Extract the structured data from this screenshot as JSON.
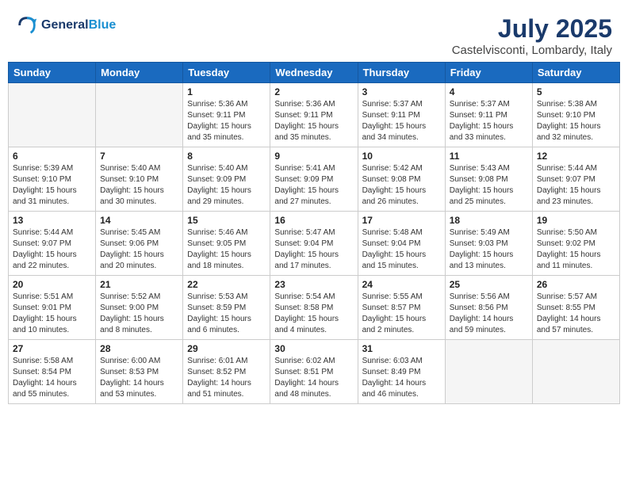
{
  "logo": {
    "line1": "General",
    "line2": "Blue"
  },
  "title": "July 2025",
  "location": "Castelvisconti, Lombardy, Italy",
  "headers": [
    "Sunday",
    "Monday",
    "Tuesday",
    "Wednesday",
    "Thursday",
    "Friday",
    "Saturday"
  ],
  "weeks": [
    [
      {
        "day": "",
        "content": ""
      },
      {
        "day": "",
        "content": ""
      },
      {
        "day": "1",
        "content": "Sunrise: 5:36 AM\nSunset: 9:11 PM\nDaylight: 15 hours\nand 35 minutes."
      },
      {
        "day": "2",
        "content": "Sunrise: 5:36 AM\nSunset: 9:11 PM\nDaylight: 15 hours\nand 35 minutes."
      },
      {
        "day": "3",
        "content": "Sunrise: 5:37 AM\nSunset: 9:11 PM\nDaylight: 15 hours\nand 34 minutes."
      },
      {
        "day": "4",
        "content": "Sunrise: 5:37 AM\nSunset: 9:11 PM\nDaylight: 15 hours\nand 33 minutes."
      },
      {
        "day": "5",
        "content": "Sunrise: 5:38 AM\nSunset: 9:10 PM\nDaylight: 15 hours\nand 32 minutes."
      }
    ],
    [
      {
        "day": "6",
        "content": "Sunrise: 5:39 AM\nSunset: 9:10 PM\nDaylight: 15 hours\nand 31 minutes."
      },
      {
        "day": "7",
        "content": "Sunrise: 5:40 AM\nSunset: 9:10 PM\nDaylight: 15 hours\nand 30 minutes."
      },
      {
        "day": "8",
        "content": "Sunrise: 5:40 AM\nSunset: 9:09 PM\nDaylight: 15 hours\nand 29 minutes."
      },
      {
        "day": "9",
        "content": "Sunrise: 5:41 AM\nSunset: 9:09 PM\nDaylight: 15 hours\nand 27 minutes."
      },
      {
        "day": "10",
        "content": "Sunrise: 5:42 AM\nSunset: 9:08 PM\nDaylight: 15 hours\nand 26 minutes."
      },
      {
        "day": "11",
        "content": "Sunrise: 5:43 AM\nSunset: 9:08 PM\nDaylight: 15 hours\nand 25 minutes."
      },
      {
        "day": "12",
        "content": "Sunrise: 5:44 AM\nSunset: 9:07 PM\nDaylight: 15 hours\nand 23 minutes."
      }
    ],
    [
      {
        "day": "13",
        "content": "Sunrise: 5:44 AM\nSunset: 9:07 PM\nDaylight: 15 hours\nand 22 minutes."
      },
      {
        "day": "14",
        "content": "Sunrise: 5:45 AM\nSunset: 9:06 PM\nDaylight: 15 hours\nand 20 minutes."
      },
      {
        "day": "15",
        "content": "Sunrise: 5:46 AM\nSunset: 9:05 PM\nDaylight: 15 hours\nand 18 minutes."
      },
      {
        "day": "16",
        "content": "Sunrise: 5:47 AM\nSunset: 9:04 PM\nDaylight: 15 hours\nand 17 minutes."
      },
      {
        "day": "17",
        "content": "Sunrise: 5:48 AM\nSunset: 9:04 PM\nDaylight: 15 hours\nand 15 minutes."
      },
      {
        "day": "18",
        "content": "Sunrise: 5:49 AM\nSunset: 9:03 PM\nDaylight: 15 hours\nand 13 minutes."
      },
      {
        "day": "19",
        "content": "Sunrise: 5:50 AM\nSunset: 9:02 PM\nDaylight: 15 hours\nand 11 minutes."
      }
    ],
    [
      {
        "day": "20",
        "content": "Sunrise: 5:51 AM\nSunset: 9:01 PM\nDaylight: 15 hours\nand 10 minutes."
      },
      {
        "day": "21",
        "content": "Sunrise: 5:52 AM\nSunset: 9:00 PM\nDaylight: 15 hours\nand 8 minutes."
      },
      {
        "day": "22",
        "content": "Sunrise: 5:53 AM\nSunset: 8:59 PM\nDaylight: 15 hours\nand 6 minutes."
      },
      {
        "day": "23",
        "content": "Sunrise: 5:54 AM\nSunset: 8:58 PM\nDaylight: 15 hours\nand 4 minutes."
      },
      {
        "day": "24",
        "content": "Sunrise: 5:55 AM\nSunset: 8:57 PM\nDaylight: 15 hours\nand 2 minutes."
      },
      {
        "day": "25",
        "content": "Sunrise: 5:56 AM\nSunset: 8:56 PM\nDaylight: 14 hours\nand 59 minutes."
      },
      {
        "day": "26",
        "content": "Sunrise: 5:57 AM\nSunset: 8:55 PM\nDaylight: 14 hours\nand 57 minutes."
      }
    ],
    [
      {
        "day": "27",
        "content": "Sunrise: 5:58 AM\nSunset: 8:54 PM\nDaylight: 14 hours\nand 55 minutes."
      },
      {
        "day": "28",
        "content": "Sunrise: 6:00 AM\nSunset: 8:53 PM\nDaylight: 14 hours\nand 53 minutes."
      },
      {
        "day": "29",
        "content": "Sunrise: 6:01 AM\nSunset: 8:52 PM\nDaylight: 14 hours\nand 51 minutes."
      },
      {
        "day": "30",
        "content": "Sunrise: 6:02 AM\nSunset: 8:51 PM\nDaylight: 14 hours\nand 48 minutes."
      },
      {
        "day": "31",
        "content": "Sunrise: 6:03 AM\nSunset: 8:49 PM\nDaylight: 14 hours\nand 46 minutes."
      },
      {
        "day": "",
        "content": ""
      },
      {
        "day": "",
        "content": ""
      }
    ]
  ]
}
